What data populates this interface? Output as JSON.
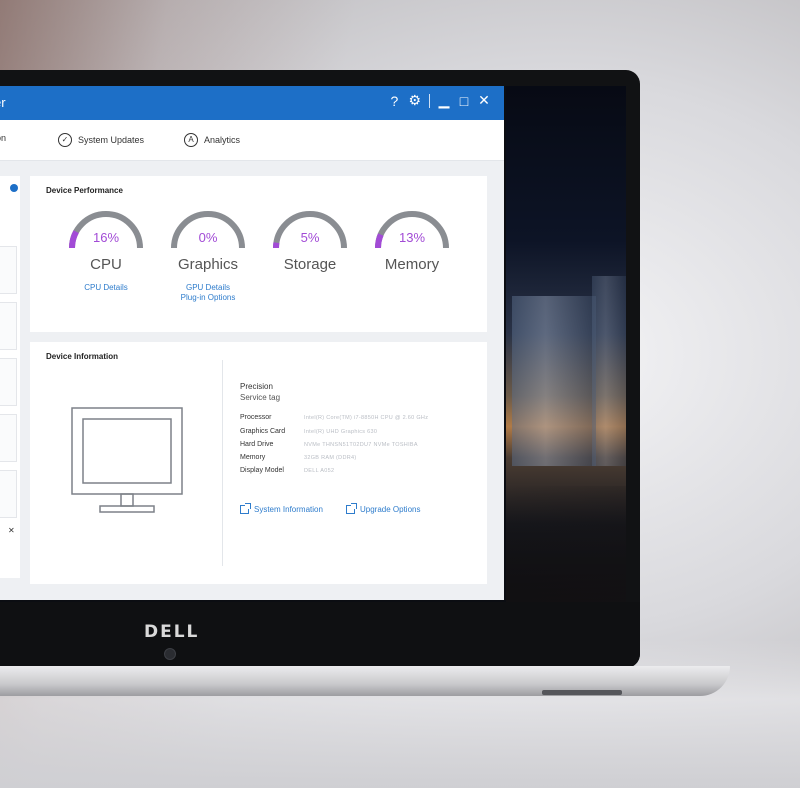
{
  "window": {
    "title": "er",
    "help_glyph": "?",
    "settings_glyph": "⚙",
    "minimize_glyph": "▁",
    "maximize_glyph": "□",
    "close_glyph": "✕"
  },
  "nav": {
    "items": [
      {
        "label": "zation",
        "icon": "partial-icon"
      },
      {
        "label": "System Updates",
        "icon": "check-circle-icon"
      },
      {
        "label": "Analytics",
        "icon": "analytics-icon"
      }
    ]
  },
  "performance": {
    "title": "Device Performance",
    "accent": "#a24bd6",
    "gauges": [
      {
        "label": "CPU",
        "percent_text": "16%",
        "value": 16
      },
      {
        "label": "Graphics",
        "percent_text": "0%",
        "value": 0
      },
      {
        "label": "Storage",
        "percent_text": "5%",
        "value": 5
      },
      {
        "label": "Memory",
        "percent_text": "13%",
        "value": 13
      }
    ],
    "links": {
      "cpu_details": "CPU Details",
      "gpu_details": "GPU Details",
      "plugin_options": "Plug-in Options"
    }
  },
  "device_info": {
    "title": "Device Information",
    "model": "Precision",
    "service_tag_label": "Service tag",
    "specs": [
      {
        "key": "Processor",
        "value": "Intel(R) Core(TM) i7-8850H CPU @ 2.60 GHz"
      },
      {
        "key": "Graphics Card",
        "value": "Intel(R) UHD Graphics 630"
      },
      {
        "key": "Hard Drive",
        "value": "NVMe THNSN51T02DU7 NVMe TOSHIBA"
      },
      {
        "key": "Memory",
        "value": "32GB RAM (DDR4)"
      },
      {
        "key": "Display Model",
        "value": "DELL A052"
      }
    ],
    "system_info_link": "System Information",
    "upgrade_link": "Upgrade Options"
  },
  "laptop": {
    "brand": "DELL"
  }
}
